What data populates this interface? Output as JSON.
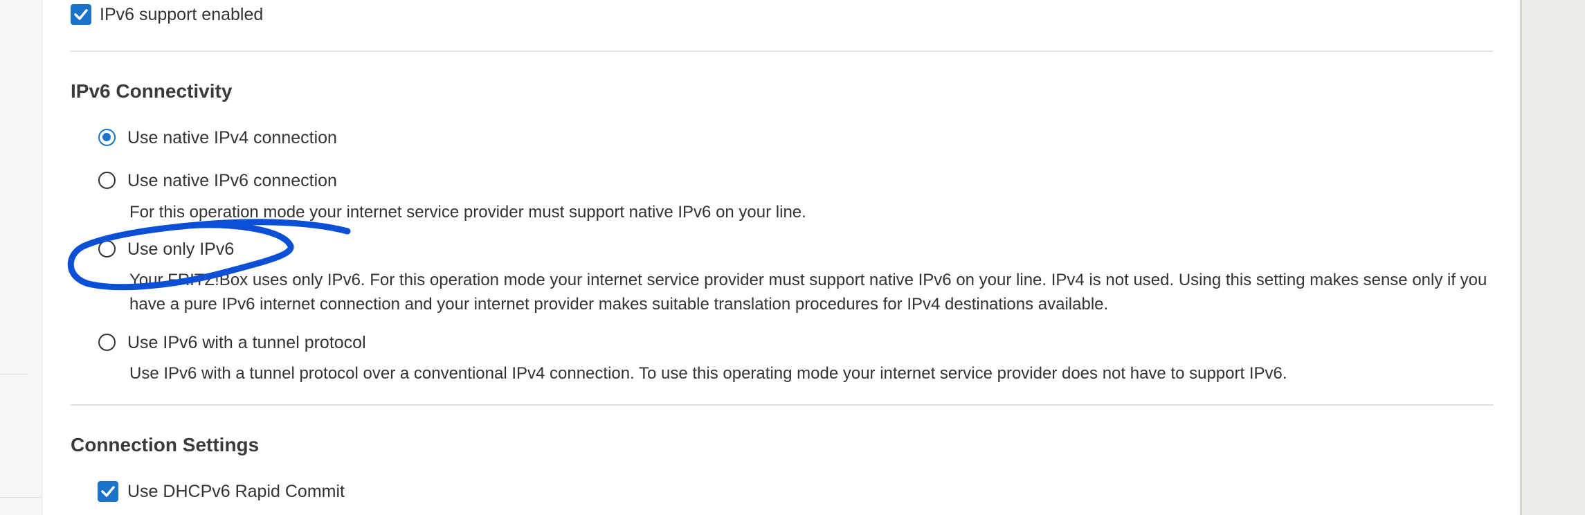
{
  "ipv6_support": {
    "label": "IPv6 support enabled",
    "checked": true
  },
  "connectivity": {
    "heading": "IPv6 Connectivity",
    "options": [
      {
        "label": "Use native IPv4 connection",
        "selected": true,
        "description": ""
      },
      {
        "label": "Use native IPv6 connection",
        "selected": false,
        "description": "For this operation mode your internet service provider must support native IPv6 on your line."
      },
      {
        "label": "Use only IPv6",
        "selected": false,
        "description": "Your FRITZ!Box uses only IPv6. For this operation mode your internet service provider must support native IPv6 on your line. IPv4 is not used. Using this setting makes sense only if you have a pure IPv6 internet connection and your internet provider makes suitable translation procedures for IPv4 destinations available."
      },
      {
        "label": "Use IPv6 with a tunnel protocol",
        "selected": false,
        "description": "Use IPv6 with a tunnel protocol over a conventional IPv4 connection. To use this operating mode your internet service provider does not have to support IPv6."
      }
    ]
  },
  "connection_settings": {
    "heading": "Connection Settings",
    "rapid_commit": {
      "label": "Use DHCPv6 Rapid Commit",
      "checked": true
    }
  },
  "colors": {
    "accent": "#1a73c9",
    "annotation": "#0a4fd6",
    "text": "#333333",
    "divider": "#e2e2e2"
  },
  "icons": [
    "checkbox-checked-icon",
    "radio-selected-icon",
    "radio-unselected-icon"
  ]
}
